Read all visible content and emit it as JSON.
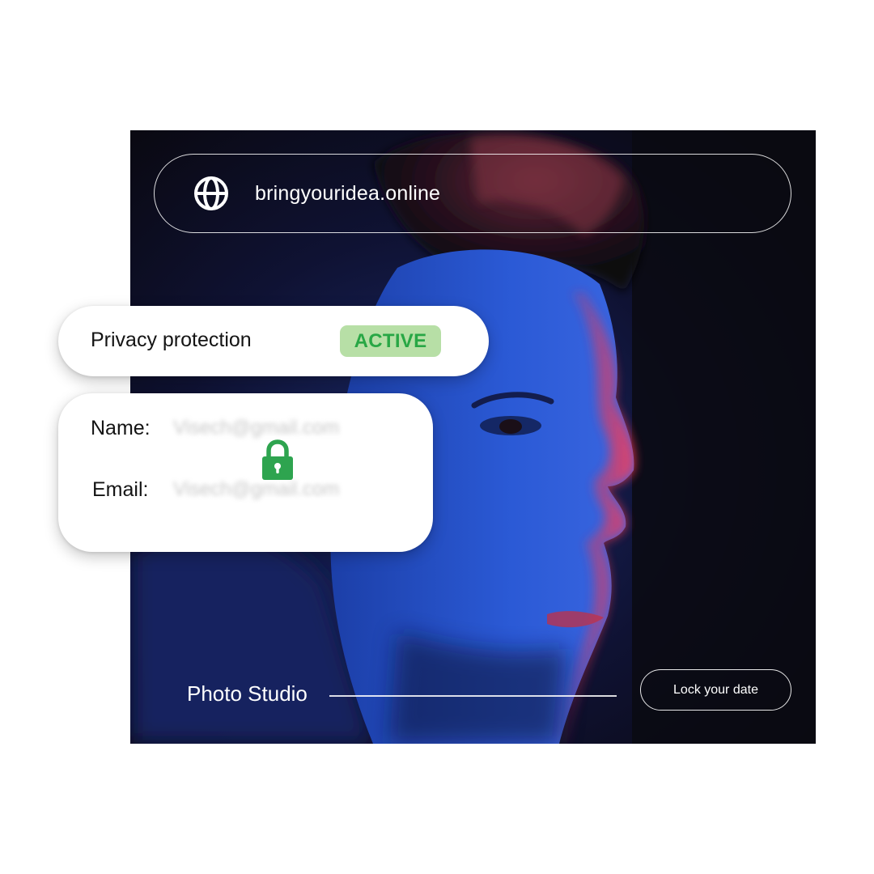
{
  "browser": {
    "url": "bringyouridea.online",
    "globe_icon": "globe-icon"
  },
  "privacy": {
    "label": "Privacy protection",
    "status": "ACTIVE",
    "status_color": "#28a745",
    "status_bg": "#b7dfa6"
  },
  "form": {
    "name_label": "Name:",
    "name_value": "Visech@gmail.com",
    "email_label": "Email:",
    "email_value": "Visech@gmail.com",
    "lock_icon": "lock-icon",
    "lock_color": "#2ea44f"
  },
  "footer": {
    "studio_label": "Photo Studio",
    "cta_label": "Lock your date"
  }
}
